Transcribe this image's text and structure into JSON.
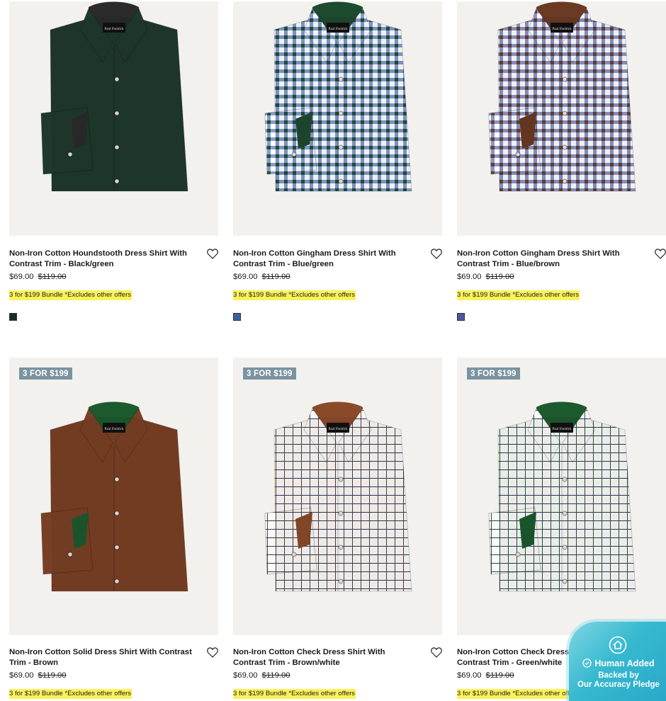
{
  "products": [
    {
      "title": "Non-Iron Cotton Houndstooth Dress Shirt With Contrast Trim - Black/green",
      "price": "$69.00",
      "was_price": "$119.00",
      "promo": "3 for $199 Bundle *Excludes other offers",
      "badge": "",
      "shirt_color": "#1f3a2c",
      "pattern": "solid",
      "collar_color": "#2b2b2b",
      "swatch_color": "#1e2b24"
    },
    {
      "title": "Non-Iron Cotton Gingham Dress Shirt With Contrast Trim - Blue/green",
      "price": "$69.00",
      "was_price": "$119.00",
      "promo": "3 for $199 Bundle *Excludes other offers",
      "badge": "",
      "shirt_color": "#2f5aa8",
      "pattern": "gingham",
      "collar_color": "#1e4a2f",
      "swatch_color": "#3b5fa5"
    },
    {
      "title": "Non-Iron Cotton Gingham Dress Shirt With Contrast Trim - Blue/brown",
      "price": "$69.00",
      "was_price": "$119.00",
      "promo": "3 for $199 Bundle *Excludes other offers",
      "badge": "",
      "shirt_color": "#3a4fa0",
      "pattern": "gingham",
      "collar_color": "#6b3a24",
      "swatch_color": "#4a5aa0"
    },
    {
      "title": "Non-Iron Cotton Solid Dress Shirt With Contrast Trim - Brown",
      "price": "$69.00",
      "was_price": "$119.00",
      "promo": "3 for $199 Bundle *Excludes other offers",
      "badge": "3 FOR $199",
      "shirt_color": "#7a4026",
      "pattern": "solid",
      "collar_color": "#1d5a2e",
      "swatch_color": "#7a4026"
    },
    {
      "title": "Non-Iron Cotton Check Dress Shirt With Contrast Trim - Brown/white",
      "price": "$69.00",
      "was_price": "$119.00",
      "promo": "3 for $199 Bundle *Excludes other offers",
      "badge": "3 FOR $199",
      "shirt_color": "#f3efe9",
      "pattern": "tattersall-brown",
      "collar_color": "#8a4a2a",
      "swatch_color": "#8a5a40"
    },
    {
      "title": "Non-Iron Cotton Check Dress Shirt With Contrast Trim - Green/white",
      "price": "$69.00",
      "was_price": "$119.00",
      "promo": "3 for $199 Bundle *Excludes other offers",
      "badge": "3 FOR $199",
      "shirt_color": "#eef2ee",
      "pattern": "tattersall-green",
      "collar_color": "#1d5a2e",
      "swatch_color": "#2e6a3e"
    }
  ],
  "label_brand": "Paul Fredrick",
  "pledge": {
    "line1": "Human Added",
    "line2": "Backed by",
    "line3": "Our Accuracy Pledge"
  },
  "colors": {
    "promo_highlight": "#fbf25a",
    "badge_bg": "#7a93a0",
    "photo_bg": "#f2f1ee",
    "pledge_teal": "#37b9d0"
  }
}
